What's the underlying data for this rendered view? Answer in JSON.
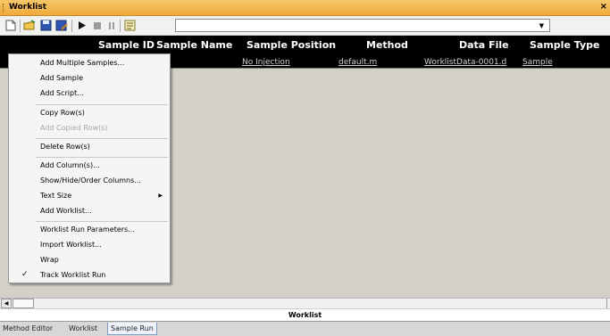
{
  "window": {
    "title": "Worklist",
    "close": "×"
  },
  "toolbar": {
    "combo_value": ""
  },
  "columns": [
    {
      "key": "sample_id",
      "label": "Sample ID"
    },
    {
      "key": "sample_name",
      "label": "Sample Name"
    },
    {
      "key": "sample_position",
      "label": "Sample Position"
    },
    {
      "key": "method",
      "label": "Method"
    },
    {
      "key": "data_file",
      "label": "Data File"
    },
    {
      "key": "sample_type",
      "label": "Sample Type"
    }
  ],
  "rows": [
    {
      "sample_position": "No Injection",
      "method": "default.m",
      "data_file": "WorklistData-0001.d",
      "sample_type": "Sample"
    }
  ],
  "context_menu": {
    "items": [
      {
        "label": "Add Multiple Samples...",
        "enabled": true
      },
      {
        "label": "Add Sample",
        "enabled": true
      },
      {
        "label": "Add Script...",
        "enabled": true
      },
      {
        "label": "Copy Row(s)",
        "enabled": true
      },
      {
        "label": "Add Copied Row(s)",
        "enabled": false
      },
      {
        "label": "Delete Row(s)",
        "enabled": true
      },
      {
        "label": "Add Column(s)...",
        "enabled": true
      },
      {
        "label": "Show/Hide/Order Columns...",
        "enabled": true
      },
      {
        "label": "Text Size",
        "enabled": true,
        "submenu": true
      },
      {
        "label": "Add Worklist...",
        "enabled": true
      },
      {
        "label": "Worklist Run Parameters...",
        "enabled": true
      },
      {
        "label": "Import Worklist...",
        "enabled": true
      },
      {
        "label": "Wrap",
        "enabled": true
      },
      {
        "label": "Track Worklist Run",
        "enabled": true,
        "checked": true
      }
    ]
  },
  "status_bar": {
    "label": "Worklist"
  },
  "bottom_tabs": [
    "Method Editor",
    "Worklist",
    "Sample Run"
  ],
  "active_tab": "Sample Run"
}
